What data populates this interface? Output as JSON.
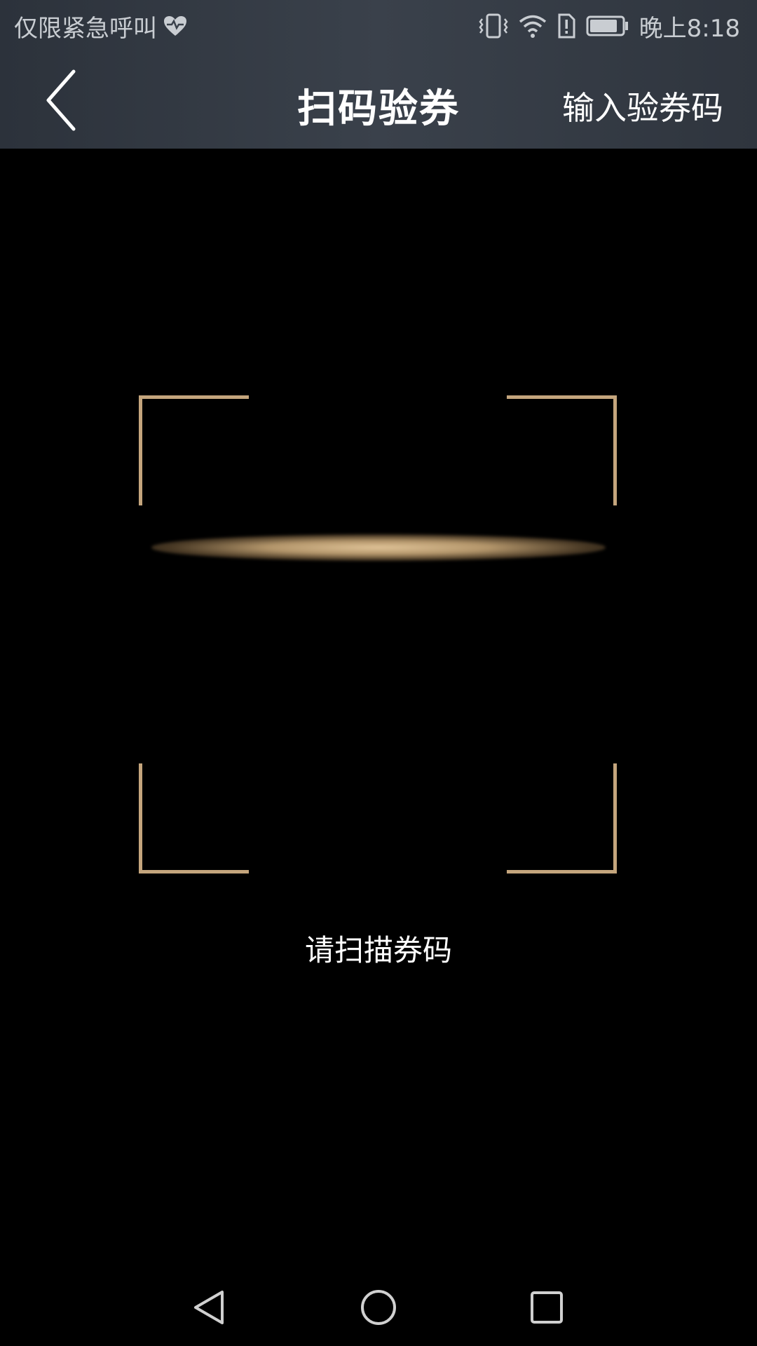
{
  "status_bar": {
    "carrier_text": "仅限紧急呼叫",
    "time": "晚上8:18",
    "icons": [
      "heart-rate-icon",
      "vibrate-icon",
      "wifi-icon",
      "sim-alert-icon",
      "battery-icon"
    ]
  },
  "app_bar": {
    "title": "扫码验券",
    "action_label": "输入验券码",
    "back_icon": "chevron-left-icon"
  },
  "scanner": {
    "hint": "请扫描券码",
    "frame_color": "#c4a57d"
  },
  "nav_bar": {
    "icons": [
      "nav-back-icon",
      "nav-home-icon",
      "nav-recent-icon"
    ]
  }
}
